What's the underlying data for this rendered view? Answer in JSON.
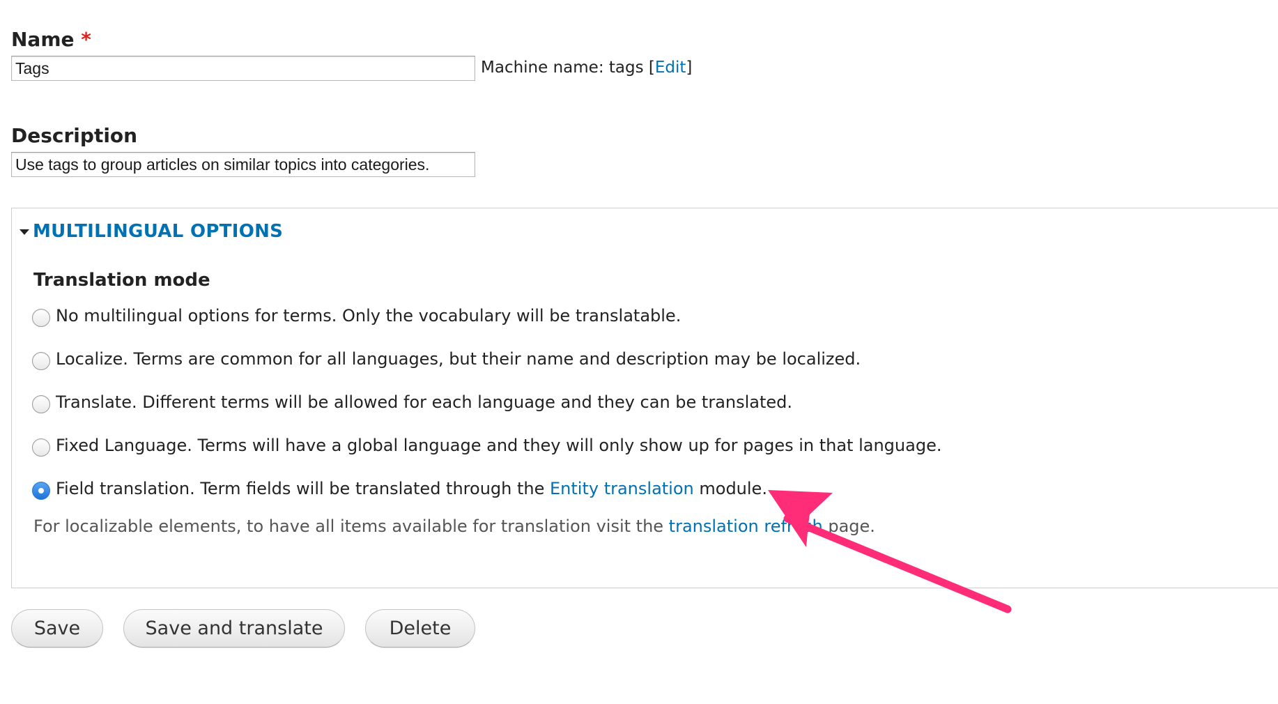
{
  "form": {
    "name": {
      "label": "Name",
      "required_marker": "*",
      "value": "Tags",
      "machine_name_prefix": "Machine name: tags [",
      "machine_name_edit": "Edit",
      "machine_name_suffix": "]"
    },
    "description": {
      "label": "Description",
      "value": "Use tags to group articles on similar topics into categories."
    },
    "multilingual": {
      "legend": "MULTILINGUAL OPTIONS",
      "translation_mode_heading": "Translation mode",
      "options": [
        {
          "label": "No multilingual options for terms. Only the vocabulary will be translatable.",
          "checked": false
        },
        {
          "label": "Localize. Terms are common for all languages, but their name and description may be localized.",
          "checked": false
        },
        {
          "label": "Translate. Different terms will be allowed for each language and they can be translated.",
          "checked": false
        },
        {
          "label": "Fixed Language. Terms will have a global language and they will only show up for pages in that language.",
          "checked": false
        },
        {
          "label_before": "Field translation. Term fields will be translated through the ",
          "label_link": "Entity translation",
          "label_after": " module.",
          "checked": true
        }
      ],
      "help_before": "For localizable elements, to have all items available for translation visit the ",
      "help_link": "translation refresh",
      "help_after": " page."
    },
    "actions": {
      "save": "Save",
      "save_translate": "Save and translate",
      "delete": "Delete"
    }
  },
  "annotation": {
    "arrow_color": "#ff2d78"
  },
  "colors": {
    "link": "#0071b3",
    "required": "#e0201b",
    "radio_checked": "#2a7bd8"
  }
}
